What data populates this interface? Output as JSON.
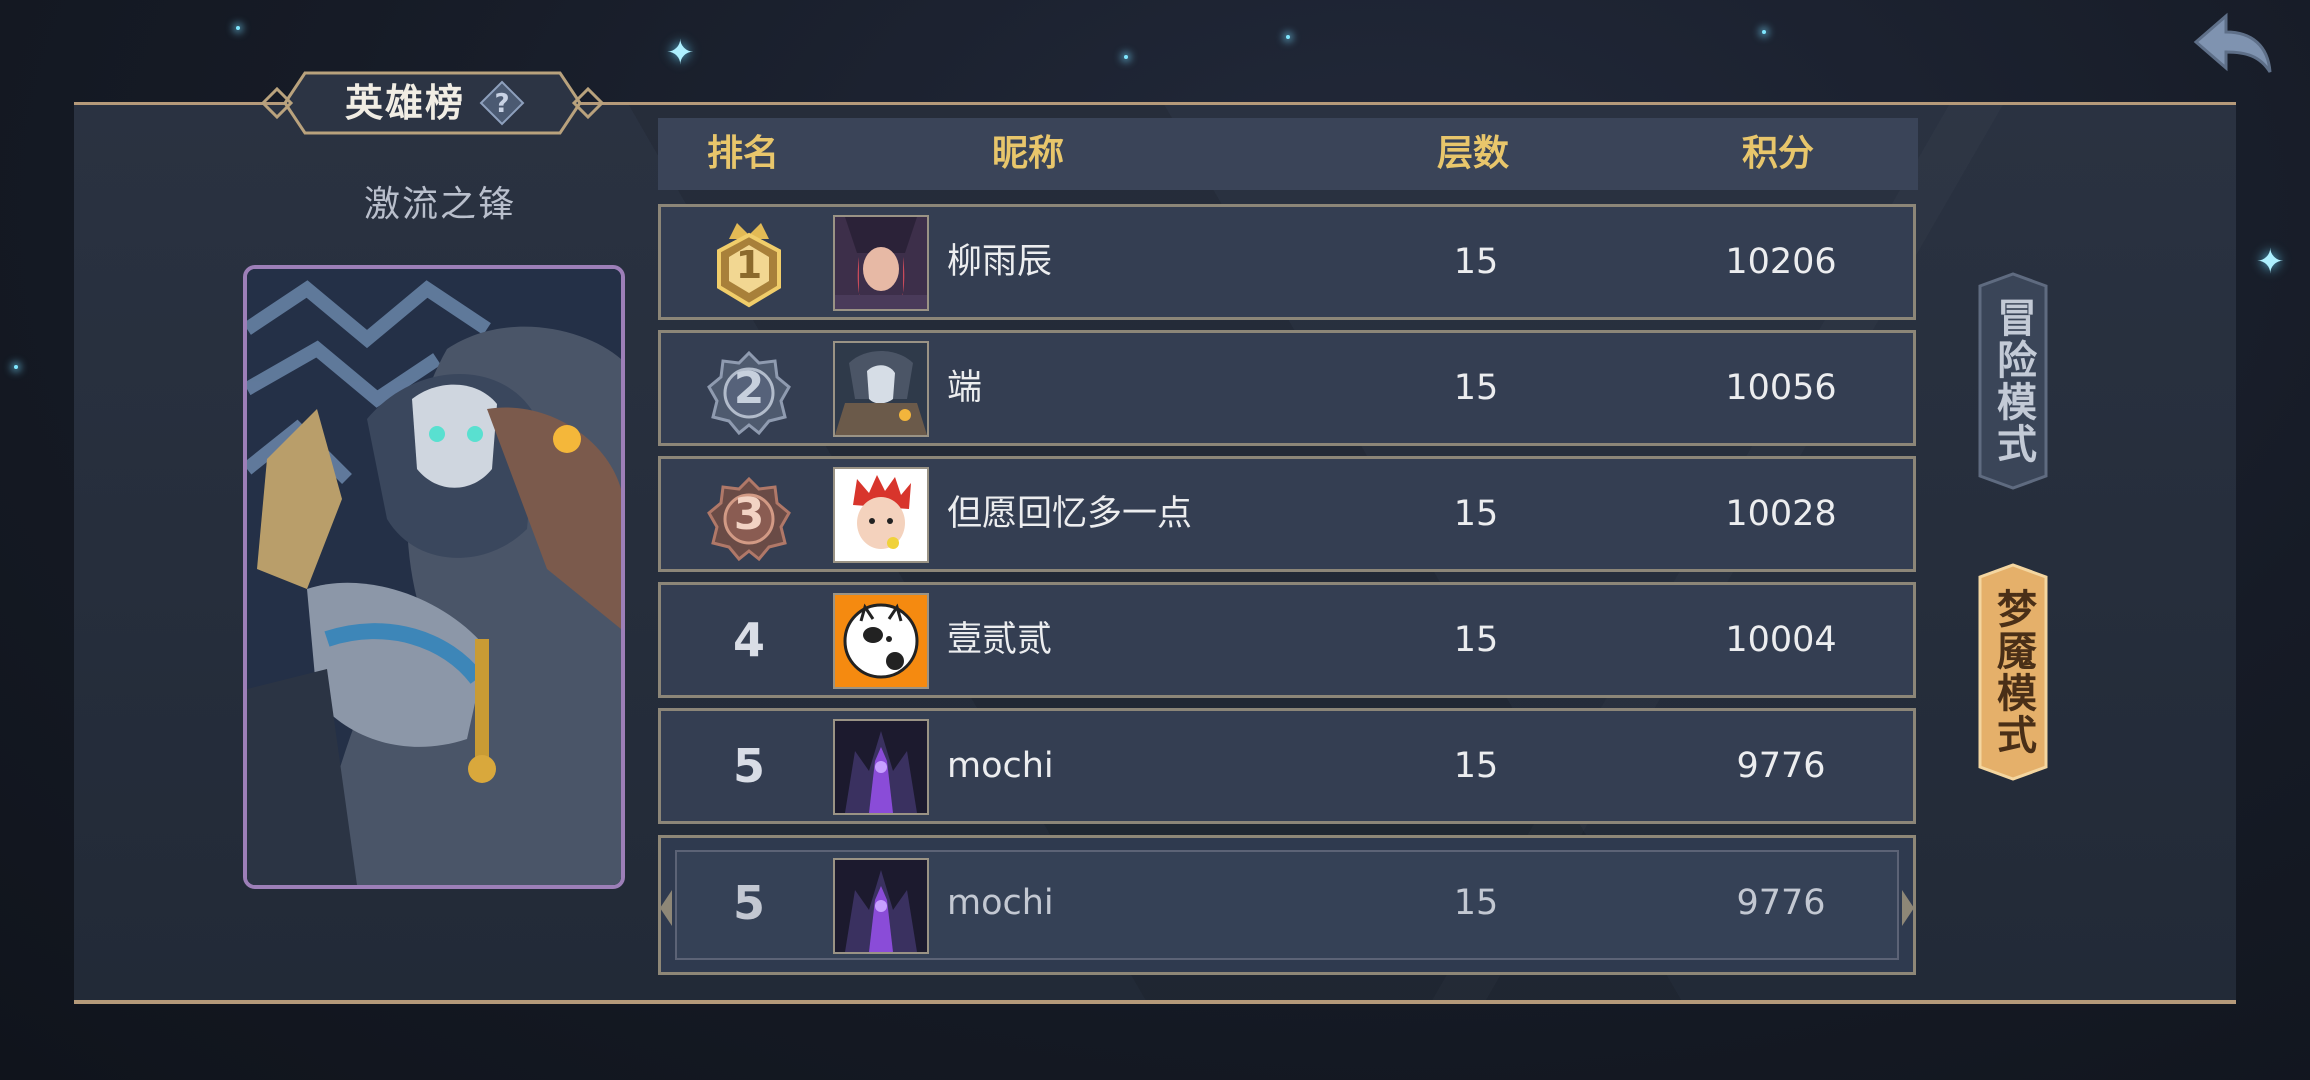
{
  "leaderboard": {
    "title": "英雄榜",
    "hero_name": "激流之锋",
    "columns": [
      "排名",
      "昵称",
      "层数",
      "积分"
    ],
    "rows": [
      {
        "rank": "1",
        "nickname": "柳雨辰",
        "layers": "15",
        "score": "10206"
      },
      {
        "rank": "2",
        "nickname": "端",
        "layers": "15",
        "score": "10056"
      },
      {
        "rank": "3",
        "nickname": "但愿回忆多一点",
        "layers": "15",
        "score": "10028"
      },
      {
        "rank": "4",
        "nickname": "壹贰贰",
        "layers": "15",
        "score": "10004"
      },
      {
        "rank": "5",
        "nickname": "mochi",
        "layers": "15",
        "score": "9776"
      }
    ],
    "my_rank": {
      "rank": "5",
      "nickname": "mochi",
      "layers": "15",
      "score": "9776"
    }
  },
  "modes": {
    "adventure": "冒险模式",
    "nightmare": "梦魇模式"
  },
  "colors": {
    "header_text": "#e8c66b",
    "gold_rank": "#d8b35a",
    "silver_rank": "#8f9bb0",
    "bronze_rank": "#b07868",
    "active_mode": "#e5b06a",
    "card_border": "#9d7fb8"
  }
}
